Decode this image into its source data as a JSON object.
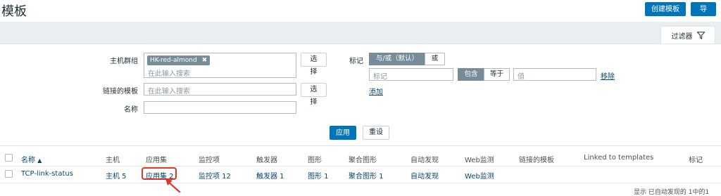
{
  "header": {
    "title": "模板",
    "create_template": "创建模板",
    "import": "导入"
  },
  "filter": {
    "tab_label": "过滤器",
    "host_group_label": "主机群组",
    "host_group_chip": "HK-red-almond",
    "host_group_placeholder": "在此输入搜索",
    "select1": "选择",
    "linked_templates_label": "链接的模板",
    "linked_templates_placeholder": "在此输入搜索",
    "select2": "选择",
    "name_label": "名称",
    "name_value": "",
    "tags_label": "标记",
    "and_or": "与/或（默认）",
    "or": "或",
    "tag_placeholder": "标记",
    "contains": "包含",
    "equals": "等于",
    "value_placeholder": "值",
    "remove": "移除",
    "add": "添加",
    "apply": "应用",
    "reset": "重设"
  },
  "table": {
    "columns": {
      "name": "名称",
      "sort_icon": "▲",
      "hosts": "主机",
      "applications": "应用集",
      "items": "监控项",
      "triggers": "触发器",
      "graphs": "图形",
      "screens": "聚合图形",
      "discovery": "自动发现",
      "web": "Web监测",
      "linked_templates": "链接的模板",
      "linked_to": "Linked to templates",
      "tags": "标记"
    },
    "rows": [
      {
        "name": "TCP-link-status",
        "hosts": "主机 5",
        "applications": "应用集 2",
        "items": "监控项 12",
        "triggers": "触发器 1",
        "graphs": "图形 1",
        "screens": "聚合图形 1",
        "discovery": "自动发现",
        "web": "Web监测"
      }
    ],
    "footer_partial": "显示 已自动发现的 1中的1"
  },
  "colors": {
    "primary": "#0275b8",
    "link": "#0a466a",
    "highlight": "#d9382b"
  }
}
